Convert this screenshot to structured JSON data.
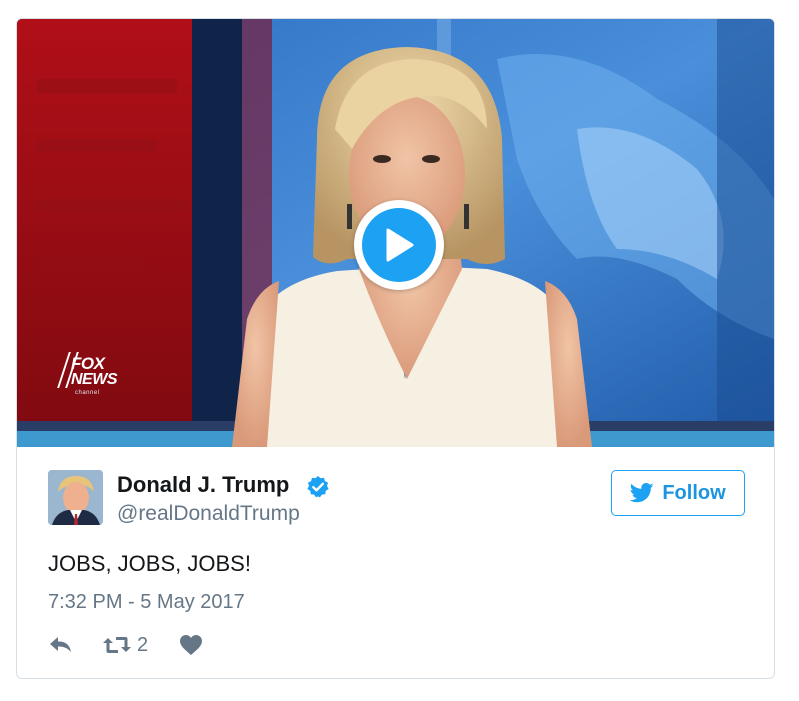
{
  "video": {
    "channel_logo": {
      "line1": "FOX",
      "line2": "NEWS",
      "line3": "channel"
    },
    "play_icon": "play-icon"
  },
  "author": {
    "name": "Donald J. Trump",
    "handle": "@realDonaldTrump",
    "verified_icon": "verified-badge-icon",
    "avatar_icon": "avatar"
  },
  "follow_button": {
    "label": "Follow",
    "icon": "twitter-bird-icon"
  },
  "tweet": {
    "text": "JOBS, JOBS, JOBS!",
    "timestamp": "7:32 PM - 5 May 2017"
  },
  "actions": {
    "reply_icon": "reply-icon",
    "retweet_icon": "retweet-icon",
    "retweet_count": "2",
    "like_icon": "heart-icon"
  },
  "colors": {
    "accent": "#1da1f2",
    "text_primary": "#14171a",
    "text_secondary": "#657786",
    "border": "#d8e0e6"
  }
}
